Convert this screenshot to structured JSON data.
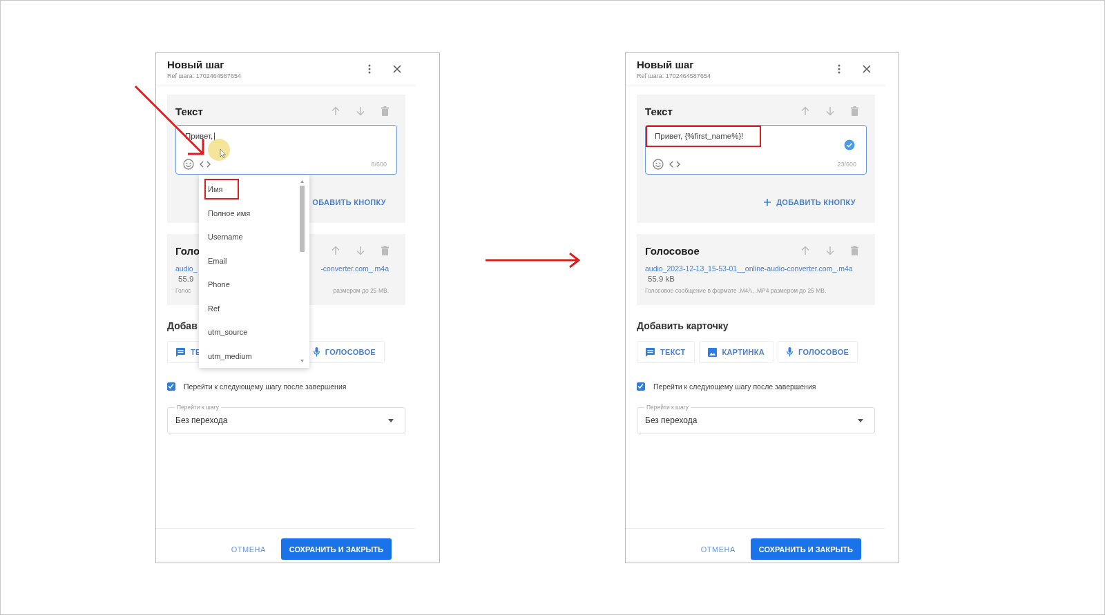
{
  "panels": [
    {
      "title": "Новый шаг",
      "ref": "Ref шага: 1702464587654",
      "pointer_highlight": true,
      "text_card": {
        "title": "Текст",
        "value": "Привет,",
        "value_highlighted": false,
        "caret": true,
        "verified": false,
        "counter": "8/600",
        "add_button": {
          "label": "ОБАВИТЬ КНОПКУ"
        }
      },
      "voice_card": {
        "title": "Голо",
        "link": [
          "audio_",
          "-converter.com_.m4a"
        ],
        "size": "55.9",
        "hint": [
          "Голос",
          "размером до 25 MB."
        ]
      },
      "add_heading": "Добав",
      "add_buttons": [
        {
          "kind": "text",
          "label": "ТЕ"
        },
        {
          "kind": "voice",
          "label": "ГОЛОСОВОЕ"
        }
      ],
      "next_step": {
        "checked": true,
        "label": "Перейти к следующему шагу после завершения"
      },
      "select": {
        "label": "Перейти к шагу",
        "value": "Без перехода"
      },
      "footer": {
        "cancel": "ОТМЕНА",
        "save": "СОХРАНИТЬ И ЗАКРЫТЬ"
      },
      "dropdown": {
        "items": [
          {
            "label": "Имя",
            "highlighted": true
          },
          {
            "label": "Полное имя",
            "highlighted": false
          },
          {
            "label": "Username",
            "highlighted": false
          },
          {
            "label": "Email",
            "highlighted": false
          },
          {
            "label": "Phone",
            "highlighted": false
          },
          {
            "label": "Ref",
            "highlighted": false
          },
          {
            "label": "utm_source",
            "highlighted": false
          },
          {
            "label": "utm_medium",
            "highlighted": false
          }
        ]
      }
    },
    {
      "title": "Новый шаг",
      "ref": "Ref шага: 1702464587654",
      "pointer_highlight": false,
      "text_card": {
        "title": "Текст",
        "value": "Привет, {%first_name%}!",
        "value_highlighted": true,
        "caret": false,
        "verified": true,
        "counter": "23/600",
        "add_button": {
          "label": "ДОБАВИТЬ КНОПКУ"
        }
      },
      "voice_card": {
        "title": "Голосовое",
        "link": [
          "audio_2023-12-13_15-53-01__online-audio-converter.com_.m4a"
        ],
        "size": "55.9 kB",
        "hint": [
          "Голосовое сообщение в формате .M4A, .MP4 размером до 25 MB."
        ]
      },
      "add_heading": "Добавить карточку",
      "add_buttons": [
        {
          "kind": "text",
          "label": "ТЕКСТ"
        },
        {
          "kind": "image",
          "label": "КАРТИНКА"
        },
        {
          "kind": "voice",
          "label": "ГОЛОСОВОЕ"
        }
      ],
      "next_step": {
        "checked": true,
        "label": "Перейти к следующему шагу после завершения"
      },
      "select": {
        "label": "Перейти к шагу",
        "value": "Без перехода"
      },
      "footer": {
        "cancel": "ОТМЕНА",
        "save": "СОХРАНИТЬ И ЗАКРЫТЬ"
      }
    }
  ]
}
